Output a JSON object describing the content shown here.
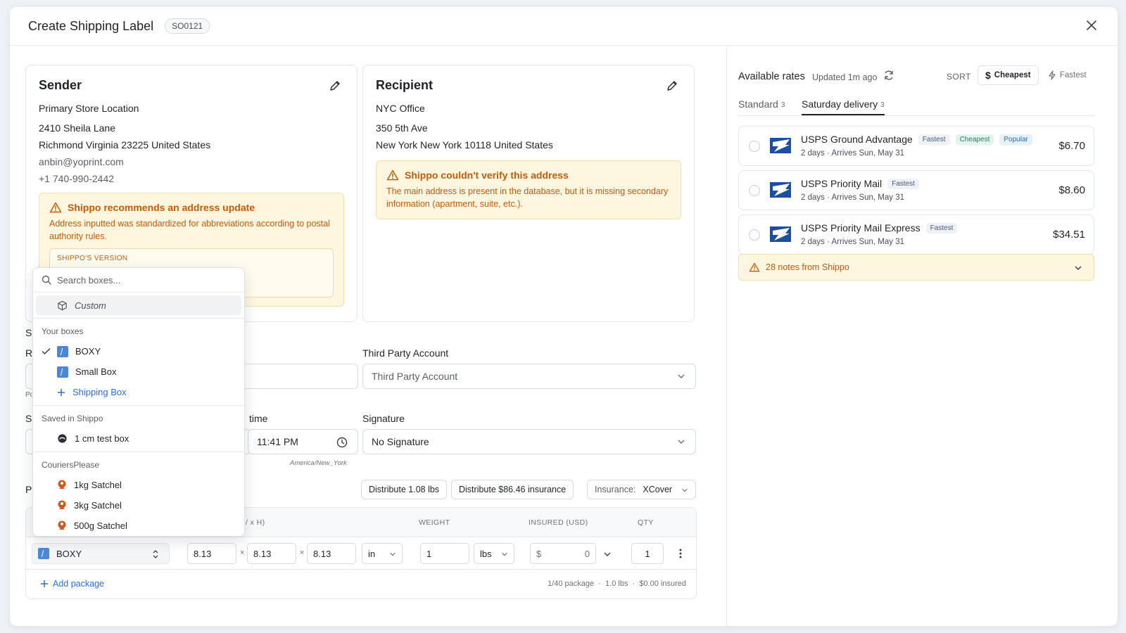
{
  "header": {
    "title": "Create Shipping Label",
    "order_badge": "SO0121"
  },
  "sender": {
    "heading": "Sender",
    "lines": [
      "Primary Store Location",
      "2410 Sheila Lane",
      "Richmond Virginia 23225 United States"
    ],
    "email": "anbin@yoprint.com",
    "phone": "+1 740-990-2442",
    "warning_title": "Shippo recommends an address update",
    "warning_text": "Address inputted was standardized for abbreviations according to postal authority rules.",
    "version_label": "SHIPPO'S VERSION"
  },
  "recipient": {
    "heading": "Recipient",
    "lines": [
      "NYC Office",
      "350 5th Ave",
      "New York New York 10118 United States"
    ],
    "warning_title": "Shippo couldn't verify this address",
    "warning_text": "The main address is present in the database, but it is missing secondary information (apartment, suite, etc.)."
  },
  "fields": {
    "third_party_label": "Third Party Account",
    "third_party_placeholder": "Third Party Account",
    "time_label_partial": "time",
    "time_value": "11:41 PM",
    "timezone": "America/New_York",
    "signature_label": "Signature",
    "signature_value": "No Signature",
    "hidden_letters": [
      "S",
      "R",
      "Po",
      "S",
      "P"
    ]
  },
  "package_actions": {
    "distribute_weight": "Distribute 1.08 lbs",
    "distribute_insurance": "Distribute $86.46 insurance",
    "insurance_label": "Insurance:",
    "insurance_value": "XCover"
  },
  "package_table": {
    "headers": {
      "dims": "/ x H)",
      "weight": "WEIGHT",
      "insured": "INSURED (USD)",
      "qty": "QTY"
    },
    "row": {
      "box": "BOXY",
      "length": "8.13",
      "width": "8.13",
      "height": "8.13",
      "times": "×",
      "dim_unit": "in",
      "weight": "1",
      "weight_unit": "lbs",
      "currency": "$",
      "insured": "0",
      "qty": "1"
    },
    "add_package": "Add package",
    "summary": "1/40 package  ·  1.0 lbs  ·  $0.00 insured"
  },
  "box_dropdown": {
    "search_placeholder": "Search boxes...",
    "custom": "Custom",
    "groups": [
      {
        "label": "Your boxes",
        "items": [
          {
            "name": "BOXY",
            "selected": true
          },
          {
            "name": "Small Box"
          }
        ],
        "add": "Shipping Box"
      },
      {
        "label": "Saved in Shippo",
        "items": [
          {
            "name": "1 cm test box"
          }
        ]
      },
      {
        "label": "CouriersPlease",
        "items": [
          {
            "name": "1kg Satchel"
          },
          {
            "name": "3kg Satchel"
          },
          {
            "name": "500g Satchel"
          }
        ]
      }
    ]
  },
  "rates": {
    "title": "Available rates",
    "updated": "Updated 1m ago",
    "sort_label": "SORT",
    "sort_cheapest": "Cheapest",
    "sort_fastest": "Fastest",
    "tabs": [
      {
        "label": "Standard",
        "count": "3"
      },
      {
        "label": "Saturday delivery",
        "count": "3",
        "active": true
      }
    ],
    "items": [
      {
        "name": "USPS Ground Advantage",
        "tags": [
          "Fastest",
          "Cheapest",
          "Popular"
        ],
        "days": "2 days",
        "arrives": "Arrives Sun, May 31",
        "price": "$6.70"
      },
      {
        "name": "USPS Priority Mail",
        "tags": [
          "Fastest"
        ],
        "days": "2 days",
        "arrives": "Arrives Sun, May 31",
        "price": "$8.60"
      },
      {
        "name": "USPS Priority Mail Express",
        "tags": [
          "Fastest"
        ],
        "days": "2 days",
        "arrives": "Arrives Sun, May 31",
        "price": "$34.51"
      }
    ],
    "notes": "28 notes from Shippo"
  },
  "colors": {
    "warning_text": "#c55a0a",
    "warning_bg": "#fff6e0",
    "link": "#2b6fd6",
    "usps_blue": "#1d4fa0"
  }
}
